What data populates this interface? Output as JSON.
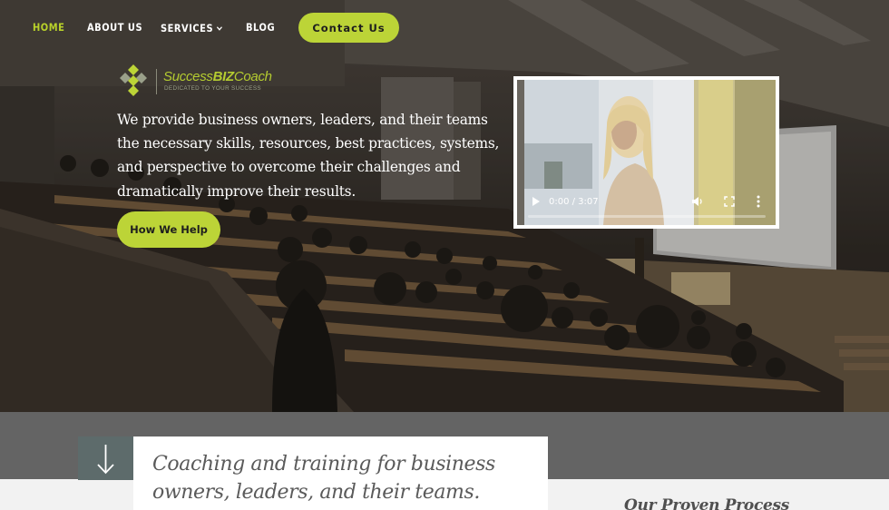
{
  "nav": {
    "items": [
      {
        "label": "HOME",
        "active": true
      },
      {
        "label": "ABOUT US",
        "active": false
      },
      {
        "label": "SERVICES",
        "active": false,
        "has_dropdown": true
      },
      {
        "label": "BLOG",
        "active": false
      }
    ],
    "contact_label": "Contact Us"
  },
  "brand": {
    "name_success": "Success",
    "name_biz": "BIZ",
    "name_coach": "Coach",
    "tagline": "DEDICATED TO YOUR SUCCESS"
  },
  "hero": {
    "text": "We provide business owners, leaders, and their teams the necessary skills, resources, best practices, systems, and perspective to overcome their challenges and dramatically improve their results.",
    "cta_label": "How We Help"
  },
  "video": {
    "time": "0:00 / 3:07",
    "progress": 0,
    "icons": [
      "play-icon",
      "volume-icon",
      "fullscreen-icon",
      "more-options-icon"
    ]
  },
  "section": {
    "quote": "Coaching and training for business owners, leaders, and their teams.",
    "proven_title": "Our Proven Process"
  },
  "colors": {
    "accent": "#bcd437",
    "band": "#646464",
    "arrow_box": "#5d6b6b"
  }
}
